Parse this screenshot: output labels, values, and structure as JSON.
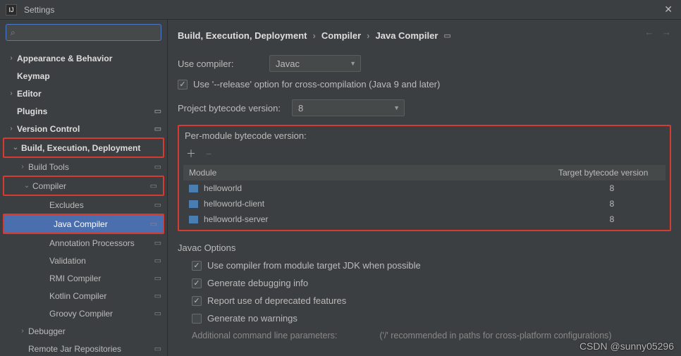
{
  "titlebar": {
    "title": "Settings"
  },
  "search": {
    "placeholder": ""
  },
  "tree": {
    "items": [
      {
        "label": "Appearance & Behavior",
        "depth": 0,
        "chev": "›",
        "gear": false
      },
      {
        "label": "Keymap",
        "depth": 0,
        "chev": "",
        "gear": false,
        "noarrow": true
      },
      {
        "label": "Editor",
        "depth": 0,
        "chev": "›",
        "gear": false
      },
      {
        "label": "Plugins",
        "depth": 0,
        "chev": "",
        "gear": true,
        "noarrow": true
      },
      {
        "label": "Version Control",
        "depth": 0,
        "chev": "›",
        "gear": true
      },
      {
        "label": "Build, Execution, Deployment",
        "depth": 0,
        "chev": "⌄",
        "gear": false,
        "red": true
      },
      {
        "label": "Build Tools",
        "depth": 1,
        "chev": "›",
        "gear": true
      },
      {
        "label": "Compiler",
        "depth": 1,
        "chev": "⌄",
        "gear": true,
        "red": true
      },
      {
        "label": "Excludes",
        "depth": 2,
        "chev": "",
        "gear": true
      },
      {
        "label": "Java Compiler",
        "depth": 2,
        "chev": "",
        "gear": true,
        "selected": true,
        "red": true
      },
      {
        "label": "Annotation Processors",
        "depth": 2,
        "chev": "",
        "gear": true
      },
      {
        "label": "Validation",
        "depth": 2,
        "chev": "",
        "gear": true
      },
      {
        "label": "RMI Compiler",
        "depth": 2,
        "chev": "",
        "gear": true
      },
      {
        "label": "Kotlin Compiler",
        "depth": 2,
        "chev": "",
        "gear": true
      },
      {
        "label": "Groovy Compiler",
        "depth": 2,
        "chev": "",
        "gear": true
      },
      {
        "label": "Debugger",
        "depth": 1,
        "chev": "›",
        "gear": false
      },
      {
        "label": "Remote Jar Repositories",
        "depth": 1,
        "chev": "",
        "gear": true
      }
    ]
  },
  "breadcrumb": {
    "a": "Build, Execution, Deployment",
    "b": "Compiler",
    "c": "Java Compiler"
  },
  "form": {
    "useCompilerLabel": "Use compiler:",
    "compilerValue": "Javac",
    "releaseOption": "Use '--release' option for cross-compilation (Java 9 and later)",
    "projBytecodeLabel": "Project bytecode version:",
    "projBytecodeValue": "8",
    "perModuleTitle": "Per-module bytecode version:",
    "colModule": "Module",
    "colTarget": "Target bytecode version",
    "rows": [
      {
        "name": "helloworld",
        "ver": "8"
      },
      {
        "name": "helloworld-client",
        "ver": "8"
      },
      {
        "name": "helloworld-server",
        "ver": "8"
      }
    ],
    "javacTitle": "Javac Options",
    "opt1": "Use compiler from module target JDK when possible",
    "opt2": "Generate debugging info",
    "opt3": "Report use of deprecated features",
    "opt4": "Generate no warnings",
    "addlLabel": "Additional command line parameters:",
    "addlHint": "('/' recommended in paths for cross-platform configurations)"
  },
  "watermark": "CSDN @sunny05296"
}
